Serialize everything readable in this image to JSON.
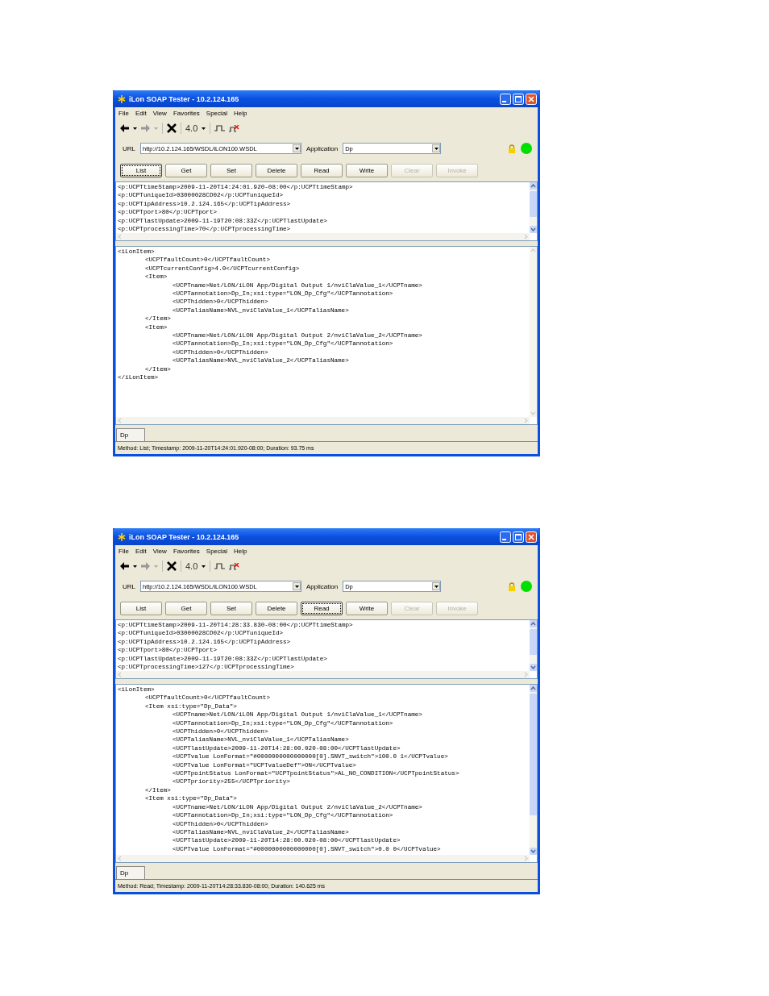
{
  "windows": [
    {
      "title": "iLon SOAP Tester - 10.2.124.165",
      "menu": [
        "File",
        "Edit",
        "View",
        "Favorites",
        "Special",
        "Help"
      ],
      "version": "4.0",
      "url_label": "URL",
      "url": "http://10.2.124.165/WSDL/iLON100.WSDL",
      "application_label": "Application",
      "application": "Dp",
      "buttons": [
        {
          "label": "List",
          "focused": true,
          "disabled": false
        },
        {
          "label": "Get",
          "focused": false,
          "disabled": false
        },
        {
          "label": "Set",
          "focused": false,
          "disabled": false
        },
        {
          "label": "Delete",
          "focused": false,
          "disabled": false
        },
        {
          "label": "Read",
          "focused": false,
          "disabled": false
        },
        {
          "label": "Write",
          "focused": false,
          "disabled": false
        },
        {
          "label": "Clear",
          "focused": false,
          "disabled": true
        },
        {
          "label": "Invoke",
          "focused": false,
          "disabled": true
        }
      ],
      "header_lines": [
        "<p:UCPTtimeStamp>2009-11-20T14:24:01.920-08:00</p:UCPTtimeStamp>",
        "<p:UCPTuniqueId>03000028CD02</p:UCPTuniqueId>",
        "<p:UCPTipAddress>10.2.124.165</p:UCPTipAddress>",
        "<p:UCPTport>80</p:UCPTport>",
        "<p:UCPTlastUpdate>2009-11-19T20:08:33Z</p:UCPTlastUpdate>",
        "<p:UCPTprocessingTime>70</p:UCPTprocessingTime>"
      ],
      "body_scrollbar_active": false,
      "body_lines": [
        {
          "text": "<iLonItem>",
          "children": [
            {
              "text": "<UCPTfaultCount>0</UCPTfaultCount>"
            },
            {
              "text": "<UCPTcurrentConfig>4.0</UCPTcurrentConfig>"
            },
            {
              "text": "<Item>",
              "children": [
                {
                  "text": "<UCPTname>Net/LON/iLON App/Digital Output 1/nviClaValue_1</UCPTname>"
                },
                {
                  "text": "<UCPTannotation>Dp_In;xsi:type=\"LON_Dp_Cfg\"</UCPTannotation>"
                },
                {
                  "text": "<UCPThidden>0</UCPThidden>"
                },
                {
                  "text": "<UCPTaliasName>NVL_nviClaValue_1</UCPTaliasName>"
                }
              ]
            },
            {
              "text": "</Item>"
            },
            {
              "text": "<Item>",
              "children": [
                {
                  "text": "<UCPTname>Net/LON/iLON App/Digital Output 2/nviClaValue_2</UCPTname>"
                },
                {
                  "text": "<UCPTannotation>Dp_In;xsi:type=\"LON_Dp_Cfg\"</UCPTannotation>"
                },
                {
                  "text": "<UCPThidden>0</UCPThidden>"
                },
                {
                  "text": "<UCPTaliasName>NVL_nviClaValue_2</UCPTaliasName>"
                }
              ]
            },
            {
              "text": "</Item>"
            }
          ]
        },
        {
          "text": "</iLonItem>"
        }
      ],
      "tabs": [
        {
          "label": "Dp",
          "selected": true
        }
      ],
      "status": "Method: List; Timestamp: 2009-11-20T14:24:01.920-08:00; Duration: 93.75 ms"
    },
    {
      "title": "iLon SOAP Tester - 10.2.124.165",
      "menu": [
        "File",
        "Edit",
        "View",
        "Favorites",
        "Special",
        "Help"
      ],
      "version": "4.0",
      "url_label": "URL",
      "url": "http://10.2.124.165/WSDL/iLON100.WSDL",
      "application_label": "Application",
      "application": "Dp",
      "buttons": [
        {
          "label": "List",
          "focused": false,
          "disabled": false
        },
        {
          "label": "Get",
          "focused": false,
          "disabled": false
        },
        {
          "label": "Set",
          "focused": false,
          "disabled": false
        },
        {
          "label": "Delete",
          "focused": false,
          "disabled": false
        },
        {
          "label": "Read",
          "focused": true,
          "disabled": false
        },
        {
          "label": "Write",
          "focused": false,
          "disabled": false
        },
        {
          "label": "Clear",
          "focused": false,
          "disabled": true
        },
        {
          "label": "Invoke",
          "focused": false,
          "disabled": true
        }
      ],
      "header_lines": [
        "<p:UCPTtimeStamp>2009-11-20T14:28:33.830-08:00</p:UCPTtimeStamp>",
        "<p:UCPTuniqueId>03000028CD02</p:UCPTuniqueId>",
        "<p:UCPTipAddress>10.2.124.165</p:UCPTipAddress>",
        "<p:UCPTport>80</p:UCPTport>",
        "<p:UCPTlastUpdate>2009-11-19T20:08:33Z</p:UCPTlastUpdate>",
        "<p:UCPTprocessingTime>127</p:UCPTprocessingTime>"
      ],
      "body_scrollbar_active": true,
      "body_lines": [
        {
          "text": "<iLonItem>",
          "children": [
            {
              "text": "<UCPTfaultCount>0</UCPTfaultCount>"
            },
            {
              "text": "<Item xsi:type=\"Dp_Data\">",
              "children": [
                {
                  "text": "<UCPTname>Net/LON/iLON App/Digital Output 1/nviClaValue_1</UCPTname>"
                },
                {
                  "text": "<UCPTannotation>Dp_In;xsi:type=\"LON_Dp_Cfg\"</UCPTannotation>"
                },
                {
                  "text": "<UCPThidden>0</UCPThidden>"
                },
                {
                  "text": "<UCPTaliasName>NVL_nviClaValue_1</UCPTaliasName>"
                },
                {
                  "text": "<UCPTlastUpdate>2009-11-20T14:28:00.020-08:00</UCPTlastUpdate>"
                },
                {
                  "text": "<UCPTvalue LonFormat=\"#0000000000000000[0].SNVT_switch\">100.0 1</UCPTvalue>"
                },
                {
                  "text": "<UCPTvalue LonFormat=\"UCPTvalueDef\">ON</UCPTvalue>"
                },
                {
                  "text": "<UCPTpointStatus LonFormat=\"UCPTpointStatus\">AL_NO_CONDITION</UCPTpointStatus>"
                },
                {
                  "text": "<UCPTpriority>255</UCPTpriority>"
                }
              ]
            },
            {
              "text": "</Item>"
            },
            {
              "text": "<Item xsi:type=\"Dp_Data\">",
              "children": [
                {
                  "text": "<UCPTname>Net/LON/iLON App/Digital Output 2/nviClaValue_2</UCPTname>"
                },
                {
                  "text": "<UCPTannotation>Dp_In;xsi:type=\"LON_Dp_Cfg\"</UCPTannotation>"
                },
                {
                  "text": "<UCPThidden>0</UCPThidden>"
                },
                {
                  "text": "<UCPTaliasName>NVL_nviClaValue_2</UCPTaliasName>"
                },
                {
                  "text": "<UCPTlastUpdate>2009-11-20T14:28:00.020-08:00</UCPTlastUpdate>"
                },
                {
                  "text": "<UCPTvalue LonFormat=\"#0000000000000000[0].SNVT_switch\">0.0 0</UCPTvalue>"
                }
              ]
            }
          ]
        }
      ],
      "tabs": [
        {
          "label": "Dp",
          "selected": true
        }
      ],
      "status": "Method: Read; Timestamp: 2009-11-20T14:28:33.830-08:00; Duration: 140.625 ms"
    }
  ]
}
